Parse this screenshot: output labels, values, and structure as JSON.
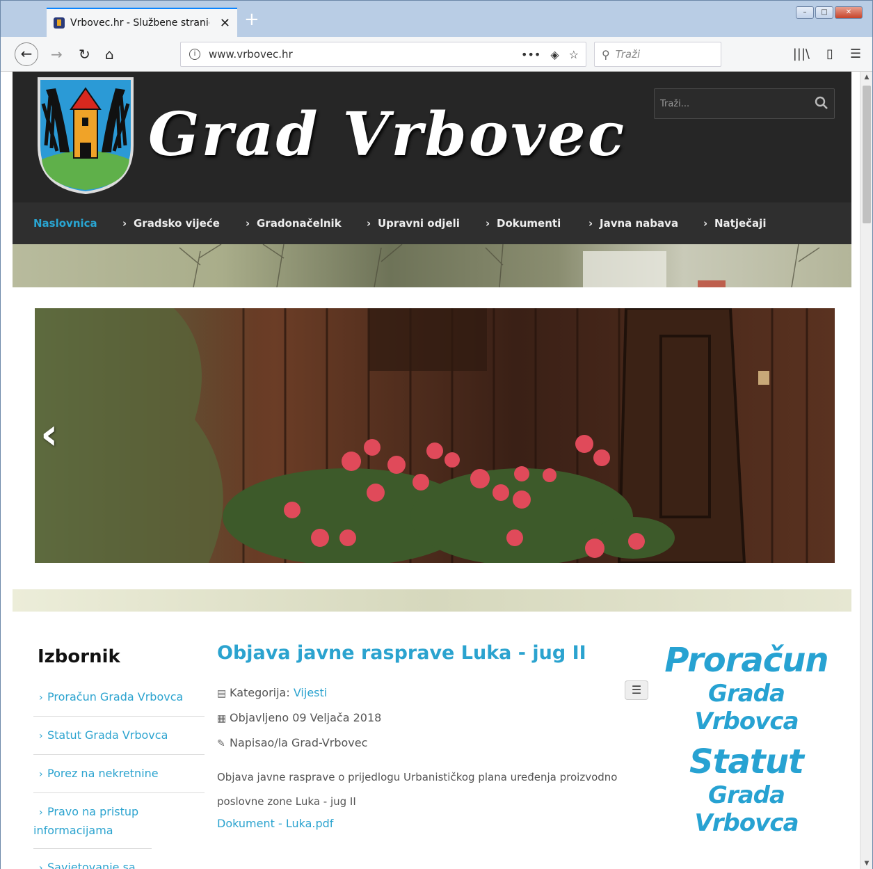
{
  "browser": {
    "tab_title": "Vrbovec.hr - Službene stranice",
    "url": "www.vrbovec.hr",
    "search_placeholder": "Traži",
    "win_minimize": "–",
    "win_maximize": "□",
    "win_close": "✕"
  },
  "header": {
    "site_title": "Grad Vrbovec",
    "search_placeholder": "Traži..."
  },
  "nav": {
    "items": [
      {
        "label": "Naslovnica",
        "active": true
      },
      {
        "label": "Gradsko vijeće",
        "active": false
      },
      {
        "label": "Gradonačelnik",
        "active": false
      },
      {
        "label": "Upravni odjeli",
        "active": false
      },
      {
        "label": "Dokumenti",
        "active": false
      },
      {
        "label": "Javna nabava",
        "active": false
      },
      {
        "label": "Natječaji",
        "active": false
      }
    ]
  },
  "sidebar": {
    "title": "Izbornik",
    "items": [
      {
        "label": "Proračun Grada Vrbovca"
      },
      {
        "label": "Statut Grada Vrbovca"
      },
      {
        "label": "Porez na nekretnine"
      },
      {
        "label": "Pravo na pristup informacijama"
      },
      {
        "label": "Savjetovanje sa"
      }
    ]
  },
  "article": {
    "title": "Objava javne rasprave Luka - jug II",
    "category_label": "Kategorija: ",
    "category_value": "Vijesti",
    "published": "Objavljeno 09 Veljača 2018",
    "author": "Napisao/la Grad-Vrbovec",
    "body": "Objava javne rasprave o prijedlogu Urbanističkog plana uređenja proizvodno poslovne zone Luka - jug II",
    "document_link": "Dokument - Luka.pdf"
  },
  "promos": [
    {
      "big": "Proračun",
      "small": "Grada Vrbovca"
    },
    {
      "big": "Statut",
      "small": "Grada Vrbovca"
    }
  ],
  "colors": {
    "accent": "#2ba3cf",
    "header_bg": "#262626",
    "nav_bg": "#2f2f2f"
  }
}
